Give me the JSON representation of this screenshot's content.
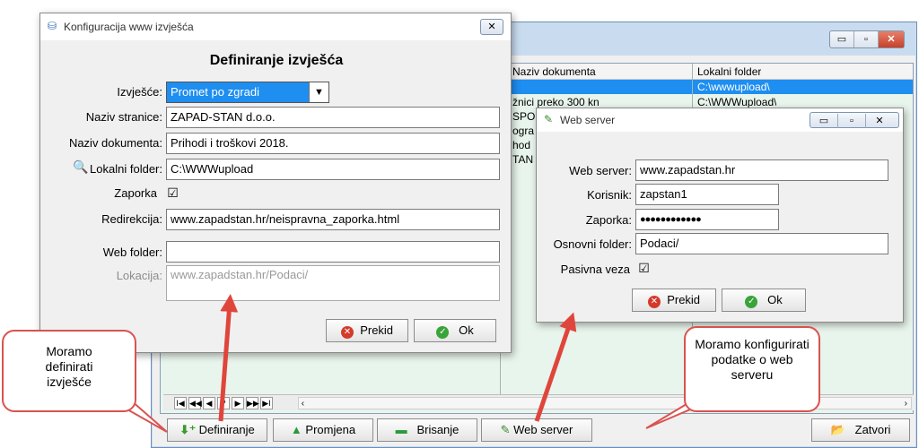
{
  "bg_window": {
    "columns": [
      "Naziv dokumenta",
      "Lokalni folder"
    ],
    "rows": [
      {
        "doc": "",
        "folder": "C:\\wwwupload\\"
      },
      {
        "doc": "žnici preko 300 kn",
        "folder": "C:\\WWWupload\\"
      },
      {
        "doc": "SPO",
        "folder": ""
      },
      {
        "doc": "ogra",
        "folder": ""
      },
      {
        "doc": "hod",
        "folder": ""
      },
      {
        "doc": "TAN",
        "folder": ""
      }
    ],
    "buttons": {
      "definiranje": "Definiranje",
      "promjena": "Promjena",
      "brisanje": "Brisanje",
      "web_server": "Web server",
      "zatvori": "Zatvori"
    },
    "nav": {
      "first": "I◀",
      "prev_page": "◀◀",
      "prev": "◀",
      "query": "?",
      "next": "▶",
      "next_page": "▶▶",
      "last": "▶I"
    }
  },
  "config_dialog": {
    "title": "Konfiguracija www izvješća",
    "heading": "Definiranje izvješća",
    "labels": {
      "izvjesce": "Izvješće:",
      "naziv_stranice": "Naziv stranice:",
      "naziv_dokumenta": "Naziv dokumenta:",
      "lokalni_folder": "Lokalni folder:",
      "zaporka": "Zaporka",
      "redirekcija": "Redirekcija:",
      "web_folder": "Web folder:",
      "lokacija": "Lokacija:"
    },
    "values": {
      "izvjesce": "Promet po zgradi",
      "naziv_stranice": "ZAPAD-STAN d.o.o.",
      "naziv_dokumenta": "Prihodi i troškovi 2018.",
      "lokalni_folder": "C:\\WWWupload",
      "zaporka_checked": "☑",
      "redirekcija": "www.zapadstan.hr/neispravna_zaporka.html",
      "web_folder": "",
      "lokacija": "www.zapadstan.hr/Podaci/"
    },
    "buttons": {
      "prekid": "Prekid",
      "ok": "Ok"
    }
  },
  "web_server_dialog": {
    "title": "Web server",
    "labels": {
      "web_server": "Web server:",
      "korisnik": "Korisnik:",
      "zaporka": "Zaporka:",
      "osnovni_folder": "Osnovni folder:",
      "pasivna_veza": "Pasivna veza"
    },
    "values": {
      "web_server": "www.zapadstan.hr",
      "korisnik": "zapstan1",
      "zaporka": "●●●●●●●●●●●●",
      "osnovni_folder": "Podaci/",
      "pasivna_veza_checked": "☑"
    },
    "buttons": {
      "prekid": "Prekid",
      "ok": "Ok"
    }
  },
  "callouts": {
    "left": "Moramo definirati izvješće",
    "right": "Moramo konfigurirati podatke o web serveru"
  },
  "colors": {
    "accent": "#1e8ef0",
    "callout_border": "#d9534f",
    "arrow": "#e0453c"
  }
}
